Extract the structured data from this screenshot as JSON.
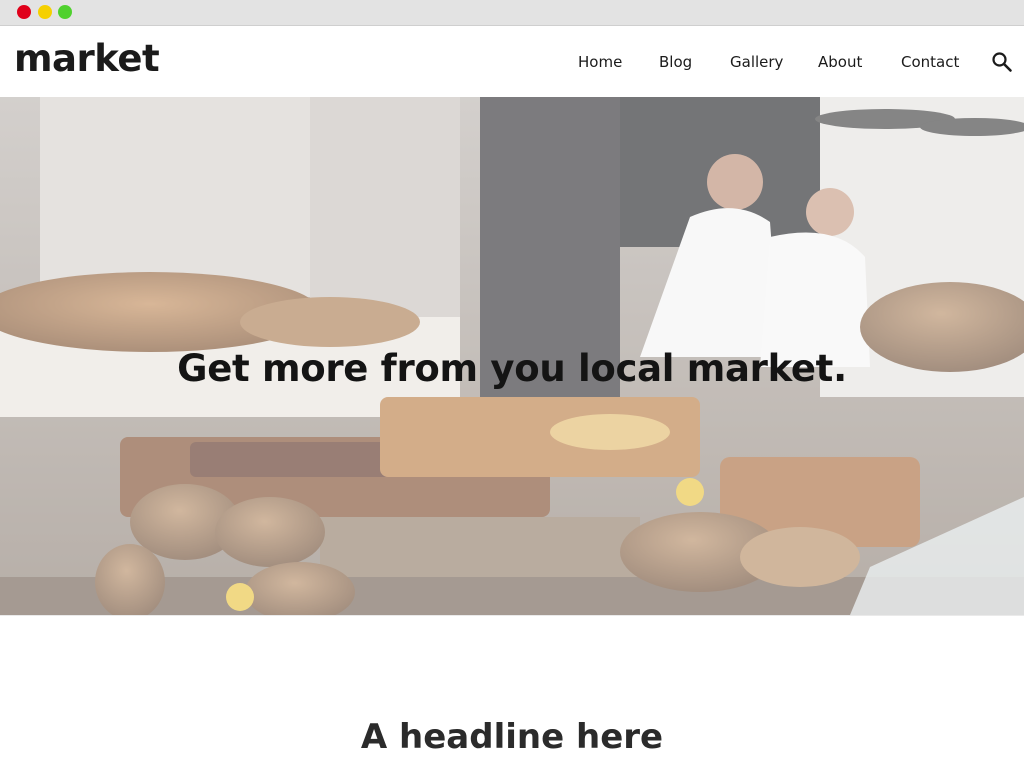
{
  "browser": {
    "buttons": [
      "close",
      "minimize",
      "maximize"
    ]
  },
  "header": {
    "logo": "market",
    "nav": [
      "Home",
      "Blog",
      "Gallery",
      "About",
      "Contact"
    ],
    "search_icon": "search-icon"
  },
  "hero": {
    "title": "Get more from you local market."
  },
  "section": {
    "headline": "A headline here"
  },
  "colors": {
    "text": "#1b1b1b",
    "close": "#e0001a",
    "minimize": "#f5d000",
    "maximize": "#4fd12e"
  }
}
